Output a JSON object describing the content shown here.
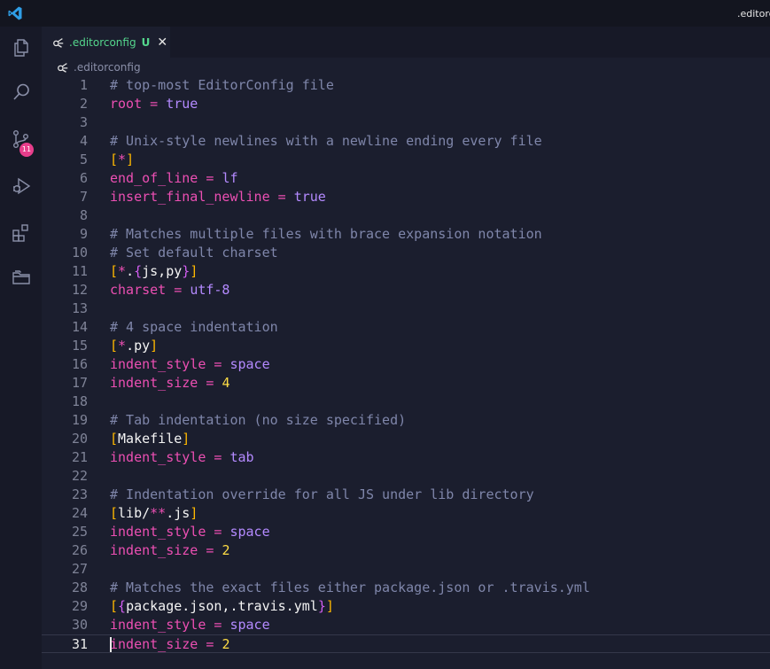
{
  "window": {
    "title": ".editorconfig - Visual Studio Code"
  },
  "activity_bar": {
    "items": [
      {
        "name": "explorer",
        "icon": "files-icon"
      },
      {
        "name": "search",
        "icon": "search-icon"
      },
      {
        "name": "source-control",
        "icon": "source-control-icon",
        "badge": "11"
      },
      {
        "name": "run-debug",
        "icon": "debug-icon"
      },
      {
        "name": "extensions",
        "icon": "extensions-icon"
      },
      {
        "name": "project-manager",
        "icon": "folders-icon"
      }
    ]
  },
  "tab": {
    "name": ".editorconfig",
    "status": "U",
    "close": "✕"
  },
  "breadcrumb": {
    "file": ".editorconfig"
  },
  "editor": {
    "active_line": 31,
    "lines": [
      [
        [
          "comment",
          "# top-most EditorConfig file"
        ]
      ],
      [
        [
          "key",
          "root"
        ],
        [
          "op",
          " = "
        ],
        [
          "val",
          "true"
        ]
      ],
      [],
      [
        [
          "comment",
          "# Unix-style newlines with a newline ending every file"
        ]
      ],
      [
        [
          "br",
          "["
        ],
        [
          "star",
          "*"
        ],
        [
          "br",
          "]"
        ]
      ],
      [
        [
          "key",
          "end_of_line"
        ],
        [
          "op",
          " = "
        ],
        [
          "val",
          "lf"
        ]
      ],
      [
        [
          "key",
          "insert_final_newline"
        ],
        [
          "op",
          " = "
        ],
        [
          "val",
          "true"
        ]
      ],
      [],
      [
        [
          "comment",
          "# Matches multiple files with brace expansion notation"
        ]
      ],
      [
        [
          "comment",
          "# Set default charset"
        ]
      ],
      [
        [
          "br",
          "["
        ],
        [
          "star",
          "*"
        ],
        [
          "sec",
          "."
        ],
        [
          "br2",
          "{"
        ],
        [
          "sec",
          "js,py"
        ],
        [
          "br2",
          "}"
        ],
        [
          "br",
          "]"
        ]
      ],
      [
        [
          "key",
          "charset"
        ],
        [
          "op",
          " = "
        ],
        [
          "val",
          "utf-8"
        ]
      ],
      [],
      [
        [
          "comment",
          "# 4 space indentation"
        ]
      ],
      [
        [
          "br",
          "["
        ],
        [
          "star",
          "*"
        ],
        [
          "sec",
          ".py"
        ],
        [
          "br",
          "]"
        ]
      ],
      [
        [
          "key",
          "indent_style"
        ],
        [
          "op",
          " = "
        ],
        [
          "val",
          "space"
        ]
      ],
      [
        [
          "key",
          "indent_size"
        ],
        [
          "op",
          " = "
        ],
        [
          "num",
          "4"
        ]
      ],
      [],
      [
        [
          "comment",
          "# Tab indentation (no size specified)"
        ]
      ],
      [
        [
          "br",
          "["
        ],
        [
          "sec",
          "Makefile"
        ],
        [
          "br",
          "]"
        ]
      ],
      [
        [
          "key",
          "indent_style"
        ],
        [
          "op",
          " = "
        ],
        [
          "val",
          "tab"
        ]
      ],
      [],
      [
        [
          "comment",
          "# Indentation override for all JS under lib directory"
        ]
      ],
      [
        [
          "br",
          "["
        ],
        [
          "sec",
          "lib/"
        ],
        [
          "star",
          "**"
        ],
        [
          "sec",
          ".js"
        ],
        [
          "br",
          "]"
        ]
      ],
      [
        [
          "key",
          "indent_style"
        ],
        [
          "op",
          " = "
        ],
        [
          "val",
          "space"
        ]
      ],
      [
        [
          "key",
          "indent_size"
        ],
        [
          "op",
          " = "
        ],
        [
          "num",
          "2"
        ]
      ],
      [],
      [
        [
          "comment",
          "# Matches the exact files either package.json or .travis.yml"
        ]
      ],
      [
        [
          "br",
          "["
        ],
        [
          "br2",
          "{"
        ],
        [
          "sec",
          "package.json,.travis.yml"
        ],
        [
          "br2",
          "}"
        ],
        [
          "br",
          "]"
        ]
      ],
      [
        [
          "key",
          "indent_style"
        ],
        [
          "op",
          " = "
        ],
        [
          "val",
          "space"
        ]
      ],
      [
        [
          "key",
          "indent_size"
        ],
        [
          "op",
          " = "
        ],
        [
          "num",
          "2"
        ]
      ]
    ]
  },
  "colors": {
    "background": "#1b1e2e",
    "key": "#ec4fb3",
    "value": "#b48aff",
    "number": "#ffdd45",
    "comment": "#7f86aa",
    "bracket": "#ffb800",
    "brace": "#d35ef2",
    "git_untracked": "#54d68c",
    "badge": "#e83e8c"
  }
}
